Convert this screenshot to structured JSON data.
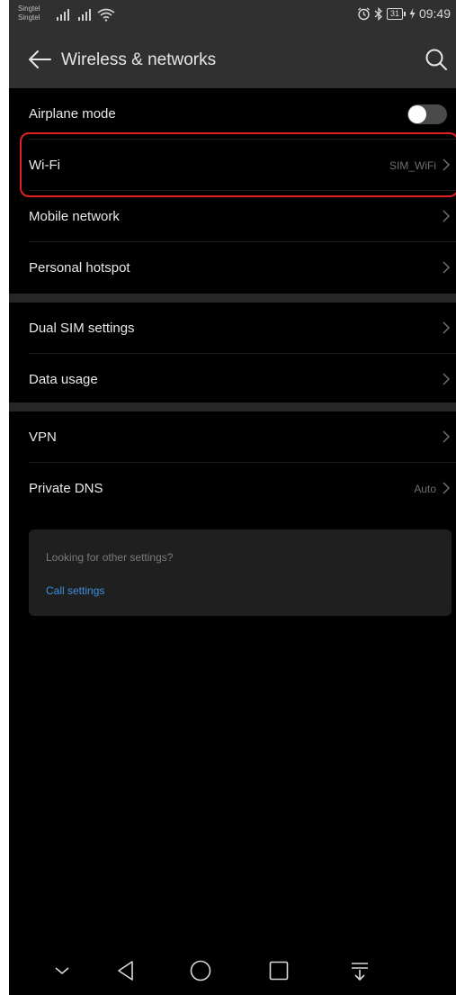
{
  "status_bar": {
    "carrier_1": "Singtel",
    "carrier_2": "Singtel",
    "battery": "31",
    "time": "09:49"
  },
  "app_bar": {
    "title": "Wireless & networks",
    "back_icon": "back-arrow-icon",
    "search_icon": "search-icon"
  },
  "groups": [
    {
      "items": [
        {
          "label": "Airplane mode",
          "control": "toggle",
          "state": "off"
        },
        {
          "label": "Wi-Fi",
          "value": "SIM_WiFi",
          "highlighted": true
        },
        {
          "label": "Mobile network"
        },
        {
          "label": "Personal hotspot"
        }
      ]
    },
    {
      "items": [
        {
          "label": "Dual SIM settings"
        },
        {
          "label": "Data usage"
        }
      ]
    },
    {
      "items": [
        {
          "label": "VPN"
        },
        {
          "label": "Private DNS",
          "value": "Auto"
        }
      ]
    }
  ],
  "suggestion_card": {
    "hint": "Looking for other settings?",
    "link": "Call settings"
  },
  "nav_bar": {
    "buttons": [
      "collapse-icon",
      "back-triangle-icon",
      "home-circle-icon",
      "recents-square-icon",
      "notification-pulldown-icon"
    ]
  },
  "colors": {
    "background": "#000000",
    "header": "#303030",
    "highlight": "#e02020",
    "link": "#3d8fe0"
  }
}
